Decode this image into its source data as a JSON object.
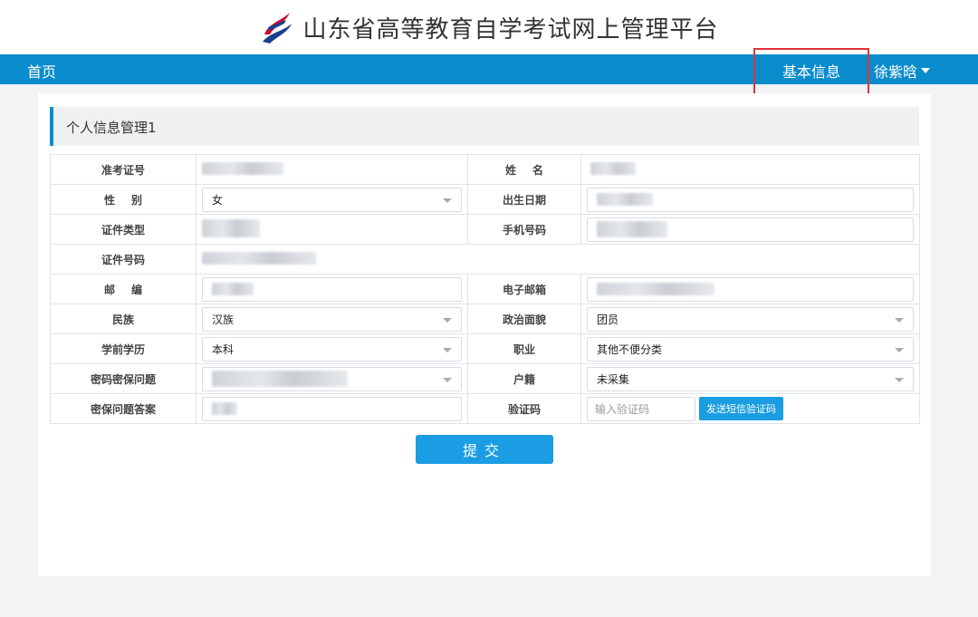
{
  "header": {
    "title": "山东省高等教育自学考试网上管理平台"
  },
  "nav": {
    "home": "首页",
    "basic_info": "基本信息",
    "user_name": "徐紫晗"
  },
  "panel": {
    "title": "个人信息管理1"
  },
  "form": {
    "exam_id_label": "准考证号",
    "name_label": "姓名",
    "gender_label": "性别",
    "gender_value": "女",
    "birth_label": "出生日期",
    "id_type_label": "证件类型",
    "phone_label": "手机号码",
    "id_no_label": "证件号码",
    "postcode_label": "邮编",
    "email_label": "电子邮箱",
    "ethnic_label": "民族",
    "ethnic_value": "汉族",
    "political_label": "政治面貌",
    "political_value": "团员",
    "edu_label": "学前学历",
    "edu_value": "本科",
    "job_label": "职业",
    "job_value": "其他不便分类",
    "question_label": "密码密保问题",
    "hukou_label": "户籍",
    "hukou_value": "未采集",
    "answer_label": "密保问题答案",
    "code_label": "验证码",
    "code_placeholder": "输入验证码",
    "sms_button": "发送短信验证码"
  },
  "submit": {
    "label": "提交"
  },
  "colors": {
    "brand": "#0a8ccc",
    "button": "#1a9de2",
    "highlight": "#e2313a"
  }
}
